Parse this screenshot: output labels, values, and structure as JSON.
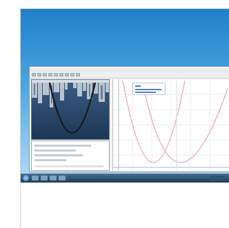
{
  "colors": {
    "desktop_top": "#1f7fc9",
    "desktop_bottom": "#b7dcf4",
    "curve": "#1a1a1a",
    "parabola": "#e7a9b5",
    "algebra_text": "#4f7fc2",
    "taskbar": "#2a4a6a"
  },
  "window": {
    "toolbar_icons": [
      "file-icon",
      "edit-icon",
      "undo-icon",
      "redo-icon",
      "pointer-icon",
      "point-icon",
      "line-icon",
      "circle-icon",
      "zoom-icon"
    ]
  },
  "taskbar": {
    "items": [
      "start-orb",
      "explorer-task",
      "browser-task",
      "media-task",
      "geogebra-task"
    ]
  }
}
